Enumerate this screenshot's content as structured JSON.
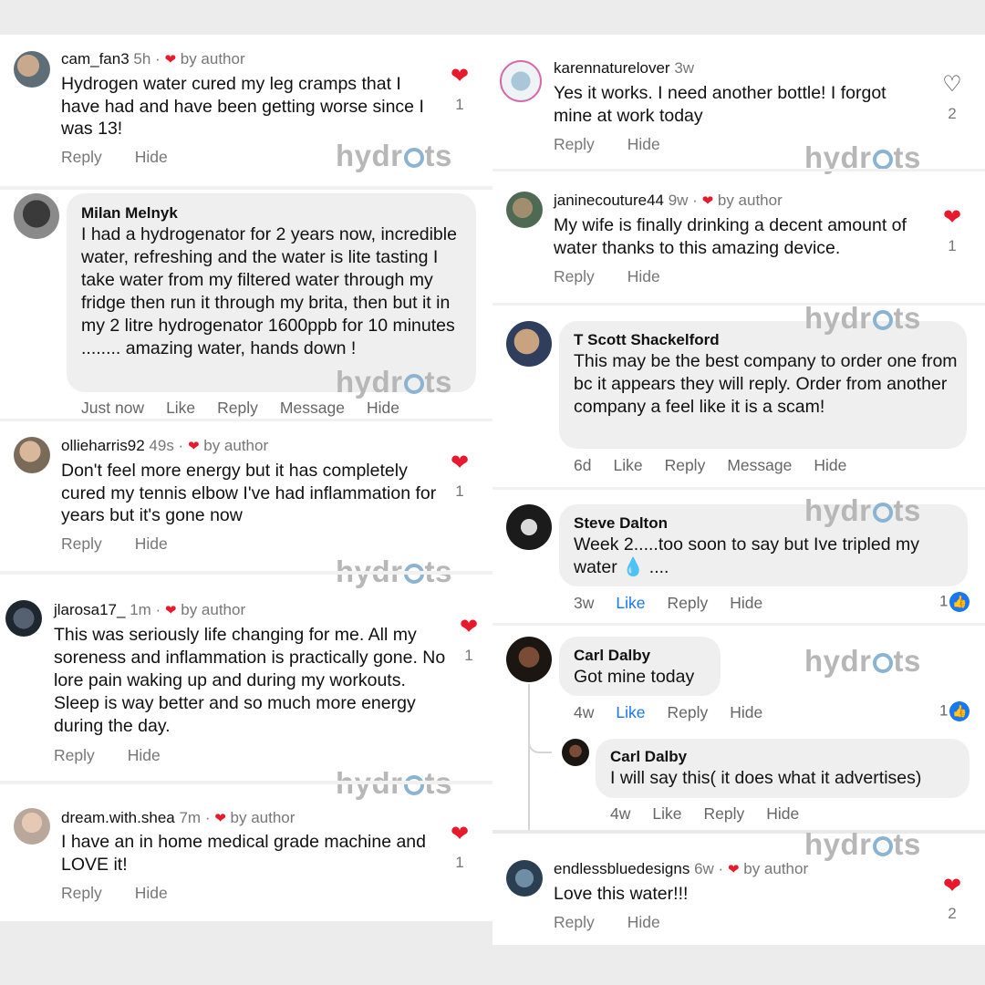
{
  "watermark": {
    "pre": "hydr",
    "post": "ts"
  },
  "colors": {
    "heart": "#e8192c",
    "fb_blue": "#1877f2",
    "watermark": "#b7b7b7"
  },
  "left": {
    "c1": {
      "user": "cam_fan3",
      "time": "5h",
      "by": "by author",
      "text": "Hydrogen water cured my leg cramps that I have had and have been getting worse since I was 13!",
      "reply": "Reply",
      "hide": "Hide",
      "likes": "1"
    },
    "c2": {
      "name": "Milan Melnyk",
      "text": "I had a hydrogenator for 2 years now, incredible water, refreshing and the water is lite tasting I take water from my filtered water through my fridge then run it through my brita, then but it in my 2 litre hydrogenator 1600ppb for 10 minutes ........ amazing water, hands down !",
      "time": "Just now",
      "like": "Like",
      "reply": "Reply",
      "message": "Message",
      "hide": "Hide"
    },
    "c3": {
      "user": "ollieharris92",
      "time": "49s",
      "by": "by author",
      "text": "Don't feel more energy but it has completely cured my tennis elbow I've had inflammation for years but it's gone now",
      "reply": "Reply",
      "hide": "Hide",
      "likes": "1"
    },
    "c4": {
      "user": "jlarosa17_",
      "time": "1m",
      "by": "by author",
      "text": "This was seriously life changing for me. All my soreness and inflammation is practically gone. No lore pain waking up and during my workouts.  Sleep is way better and so much more energy during the day.",
      "reply": "Reply",
      "hide": "Hide",
      "likes": "1"
    },
    "c5": {
      "user": "dream.with.shea",
      "time": "7m",
      "by": "by author",
      "text": "I have an in home medical grade machine and LOVE it!",
      "reply": "Reply",
      "hide": "Hide",
      "likes": "1"
    }
  },
  "right": {
    "c1": {
      "user": "karennaturelover",
      "time": "3w",
      "text": "Yes it works. I need another bottle! I forgot mine at work today",
      "reply": "Reply",
      "hide": "Hide",
      "likes": "2"
    },
    "c2": {
      "user": "janinecouture44",
      "time": "9w",
      "by": "by author",
      "text": "My wife is finally drinking a decent amount of water thanks to this amazing device.",
      "reply": "Reply",
      "hide": "Hide",
      "likes": "1"
    },
    "c3": {
      "name": "T Scott Shackelford",
      "text": "This may be the best company to order one from bc it appears they will reply. Order from another company a feel like it is a scam!",
      "time": "6d",
      "like": "Like",
      "reply": "Reply",
      "message": "Message",
      "hide": "Hide"
    },
    "c4": {
      "name": "Steve Dalton",
      "text": "Week 2.....too soon to say but Ive tripled my water 💧 ....",
      "time": "3w",
      "like": "Like",
      "reply": "Reply",
      "hide": "Hide",
      "likes": "1"
    },
    "c5": {
      "name": "Carl Dalby",
      "text": "Got mine today",
      "time": "4w",
      "like": "Like",
      "reply": "Reply",
      "hide": "Hide",
      "likes": "1"
    },
    "c6": {
      "name": "Carl Dalby",
      "text": "I will say this( it does what it advertises)",
      "time": "4w",
      "like": "Like",
      "reply": "Reply",
      "hide": "Hide"
    },
    "c7": {
      "user": "endlessbluedesigns",
      "time": "6w",
      "by": "by author",
      "text": "Love this water!!!",
      "reply": "Reply",
      "hide": "Hide",
      "likes": "2"
    }
  }
}
